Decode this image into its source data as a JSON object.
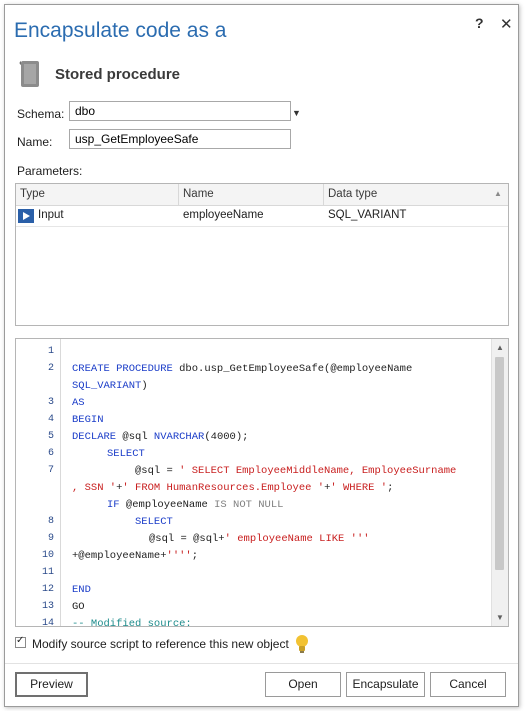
{
  "window": {
    "title": "Encapsulate code as a",
    "help_label": "?",
    "close_label": "✕"
  },
  "object_type": {
    "label": "Stored procedure"
  },
  "form": {
    "schema_label": "Schema:",
    "schema_value": "dbo",
    "name_label": "Name:",
    "name_value": "usp_GetEmployeeSafe"
  },
  "parameters": {
    "label": "Parameters:",
    "columns": [
      "Type",
      "Name",
      "Data type"
    ],
    "rows": [
      {
        "type": "Input",
        "name": "employeeName",
        "data_type": "SQL_VARIANT"
      }
    ]
  },
  "code": {
    "line_numbers": [
      "1",
      "2",
      "",
      "3",
      "4",
      "5",
      "6",
      "7",
      "",
      "8",
      "9",
      "10",
      "",
      "11",
      "12",
      "13",
      "14"
    ],
    "lines": {
      "l2a_kw": "CREATE PROCEDURE",
      "l2a_rest": " dbo.usp_GetEmployeeSafe(@employeeName",
      "l2b_kw": "SQL_VARIANT",
      "l2b_rest": ")",
      "l3": "AS",
      "l4": "BEGIN",
      "l5_kw1": "DECLARE",
      "l5_mid": " @sql ",
      "l5_kw2": "NVARCHAR",
      "l5_rest": "(4000);",
      "l6": "SELECT",
      "l7a_pre": "@sql = ",
      "l7a_str": "' SELECT EmployeeMiddleName, EmployeeSurname",
      "l7b_str1": ", SSN '",
      "l7b_mid": "+",
      "l7b_str2": "' FROM HumanResources.Employee '",
      "l7b_mid2": "+",
      "l7b_str3": "' WHERE '",
      "l7b_rest": ";",
      "l8_kw": "IF",
      "l8_mid": " @employeeName ",
      "l8_gray": "IS NOT NULL",
      "l9": "SELECT",
      "l10a_pre": "@sql = @sql+",
      "l10a_str": "' employeeName LIKE '''",
      "l10b_pre": "+@employeeName+",
      "l10b_str": "''''",
      "l10b_rest": ";",
      "l12": "END",
      "l13": "GO",
      "l14": "-- Modified source:"
    }
  },
  "modify_source": {
    "label": "Modify source script to reference this new object",
    "checked": true
  },
  "buttons": {
    "preview": "Preview",
    "open": "Open",
    "encapsulate": "Encapsulate",
    "cancel": "Cancel"
  }
}
